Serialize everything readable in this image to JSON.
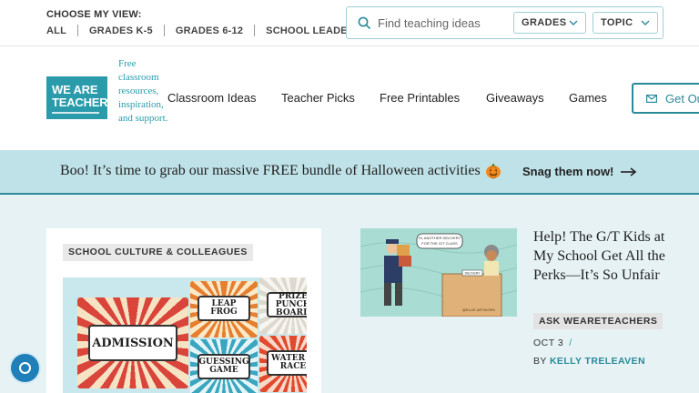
{
  "topbar": {
    "view_label": "CHOOSE MY VIEW:",
    "view_links": [
      "ALL",
      "GRADES K-5",
      "GRADES 6-12",
      "SCHOOL LEADERS"
    ],
    "search_placeholder": "Find teaching ideas",
    "filters": {
      "grades": "GRADES",
      "topic": "TOPIC"
    }
  },
  "brand": {
    "logo_line1": "WE ARE",
    "logo_line2": "TEACHERS",
    "tagline": "Free classroom resources, inspiration, and support.",
    "color": "#2a9bab"
  },
  "nav": {
    "items": [
      "Classroom Ideas",
      "Teacher Picks",
      "Free Printables",
      "Giveaways",
      "Games"
    ],
    "cta": "Get Ou"
  },
  "banner": {
    "text": "Boo! It’s time to grab our massive FREE bundle of Halloween activities",
    "link": "Snag them now!"
  },
  "feature_card": {
    "category": "SCHOOL CULTURE & COLLEAGUES",
    "tickets": {
      "main": "ADMISSION",
      "leap": "LEAP FROG",
      "prize": "PRIZE PUNCH BOARD",
      "guess": "GUESSING GAME",
      "water": "WATER G RACE"
    }
  },
  "article": {
    "title": "Help! The G/T Kids at My School Get All the Perks—It’s So Unfair",
    "image_caption": "HI, ANOTHER DELIVERY FOR THE G/T CLASS",
    "image_sign": "DELIVERY",
    "image_credit": "@ELLIE ARTWORK",
    "category": "ASK WEARETEACHERS",
    "date": "OCT 3",
    "date_sep": "/",
    "author_prefix": "BY",
    "author": "KELLY TRELEAVEN"
  }
}
